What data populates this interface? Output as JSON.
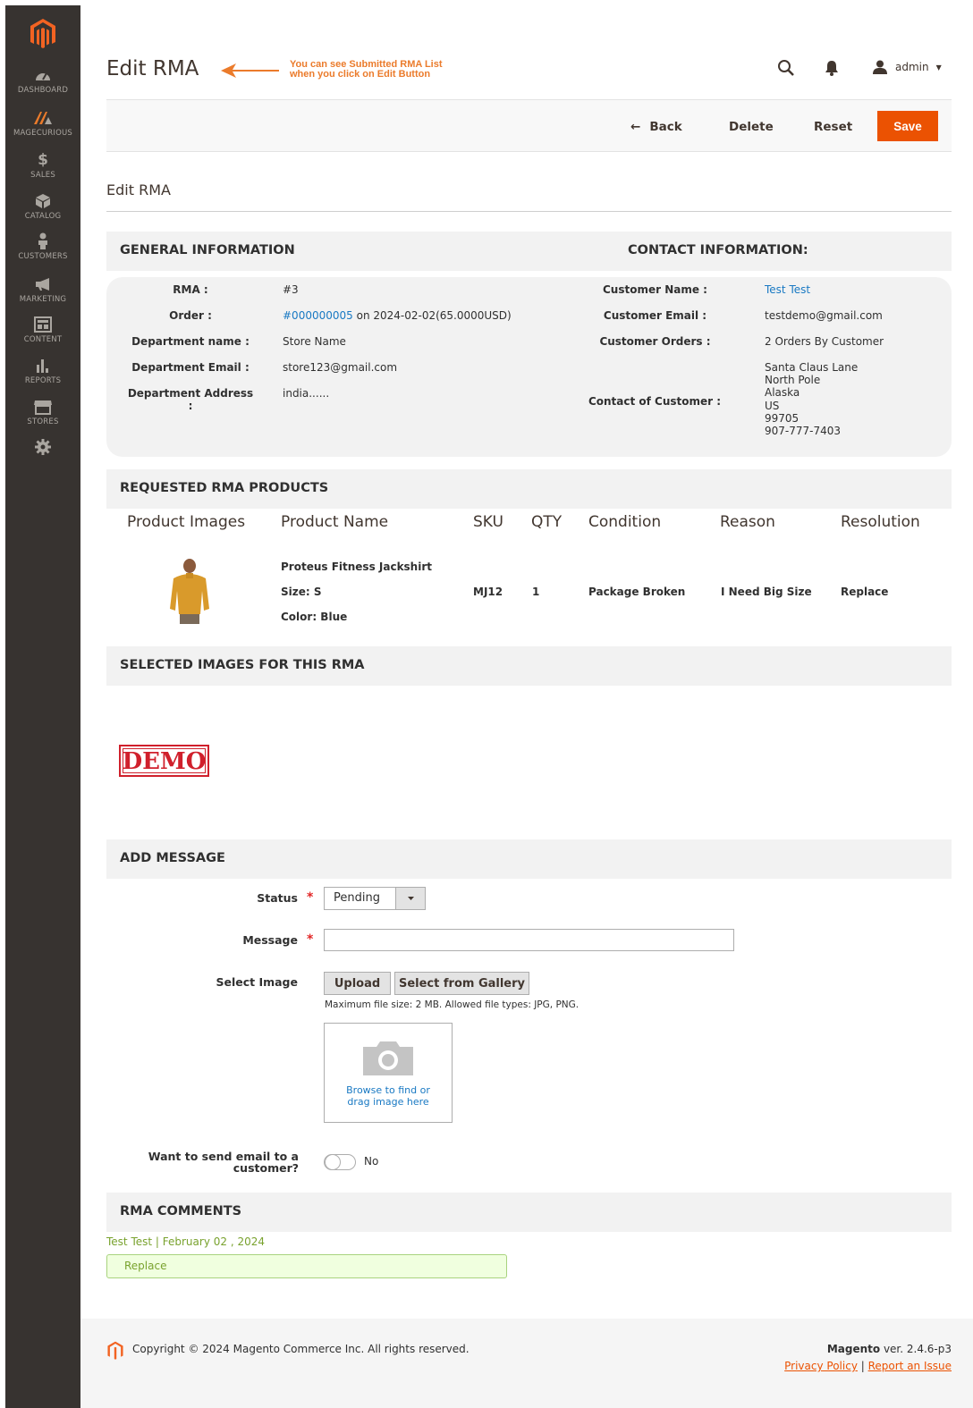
{
  "sidebar": {
    "items": [
      {
        "label": "DASHBOARD",
        "icon": "dashboard-icon"
      },
      {
        "label": "MAGECURIOUS",
        "icon": "magecurious-icon"
      },
      {
        "label": "SALES",
        "icon": "dollar-icon"
      },
      {
        "label": "CATALOG",
        "icon": "box-icon"
      },
      {
        "label": "CUSTOMERS",
        "icon": "person-icon"
      },
      {
        "label": "MARKETING",
        "icon": "megaphone-icon"
      },
      {
        "label": "CONTENT",
        "icon": "layout-icon"
      },
      {
        "label": "REPORTS",
        "icon": "bar-chart-icon"
      },
      {
        "label": "STORES",
        "icon": "store-icon"
      },
      {
        "label": "",
        "icon": "gear-icon"
      }
    ]
  },
  "header": {
    "title": "Edit RMA",
    "annotation_line1": "You can see Submitted RMA List",
    "annotation_line2": "when you click on Edit Button",
    "user": "admin"
  },
  "actions": {
    "back": "Back",
    "delete": "Delete",
    "reset": "Reset",
    "save": "Save"
  },
  "subtitle": "Edit RMA",
  "general": {
    "heading": "GENERAL INFORMATION",
    "rma_label": "RMA :",
    "rma_value": "#3",
    "order_label": "Order :",
    "order_link": "#000000005",
    "order_rest": " on 2024-02-02(65.0000USD)",
    "dept_name_label": "Department name :",
    "dept_name_value": "Store Name",
    "dept_email_label": "Department Email :",
    "dept_email_value": "store123@gmail.com",
    "dept_address_label": "Department Address :",
    "dept_address_value": "india......"
  },
  "contact": {
    "heading": "CONTACT INFORMATION:",
    "name_label": "Customer Name :",
    "name_value": "Test Test",
    "email_label": "Customer Email :",
    "email_value": "testdemo@gmail.com",
    "orders_label": "Customer Orders :",
    "orders_value": "2 Orders By Customer",
    "address_label": "Contact of Customer :",
    "address_lines": [
      "Santa Claus Lane",
      "North Pole",
      "Alaska",
      "US",
      "99705",
      "907-777-7403"
    ]
  },
  "products": {
    "heading": "REQUESTED RMA PRODUCTS",
    "columns": [
      "Product Images",
      "Product Name",
      "SKU",
      "QTY",
      "Condition",
      "Reason",
      "Resolution"
    ],
    "row": {
      "name": "Proteus Fitness Jackshirt",
      "size": "Size: S",
      "color": "Color: Blue",
      "sku": "MJ12",
      "qty": "1",
      "condition": "Package Broken",
      "reason": "I Need Big Size",
      "resolution": "Replace"
    }
  },
  "images": {
    "heading": "SELECTED IMAGES FOR THIS RMA",
    "stamp_text": "DEMO"
  },
  "message": {
    "heading": "ADD MESSAGE",
    "status_label": "Status",
    "status_value": "Pending",
    "message_label": "Message",
    "select_image_label": "Select Image",
    "upload": "Upload",
    "gallery": "Select from Gallery",
    "hint": "Maximum file size: 2 MB. Allowed file types: JPG, PNG.",
    "dz_line1": "Browse to find or",
    "dz_line2": "drag image here",
    "email_label_1": "Want to send email to a",
    "email_label_2": "customer?",
    "toggle_value": "No"
  },
  "comments": {
    "heading": "RMA COMMENTS",
    "meta": "Test Test | February 02 , 2024",
    "text": "Replace"
  },
  "footer": {
    "copyright": "Copyright © 2024 Magento Commerce Inc. All rights reserved.",
    "brand": "Magento",
    "version": " ver. 2.4.6-p3",
    "privacy": "Privacy Policy",
    "sep": " | ",
    "report": "Report an Issue"
  },
  "colors": {
    "accent": "#eb5202",
    "sidebar": "#373330",
    "link": "#1979c3",
    "annotation": "#eb7b2b"
  }
}
